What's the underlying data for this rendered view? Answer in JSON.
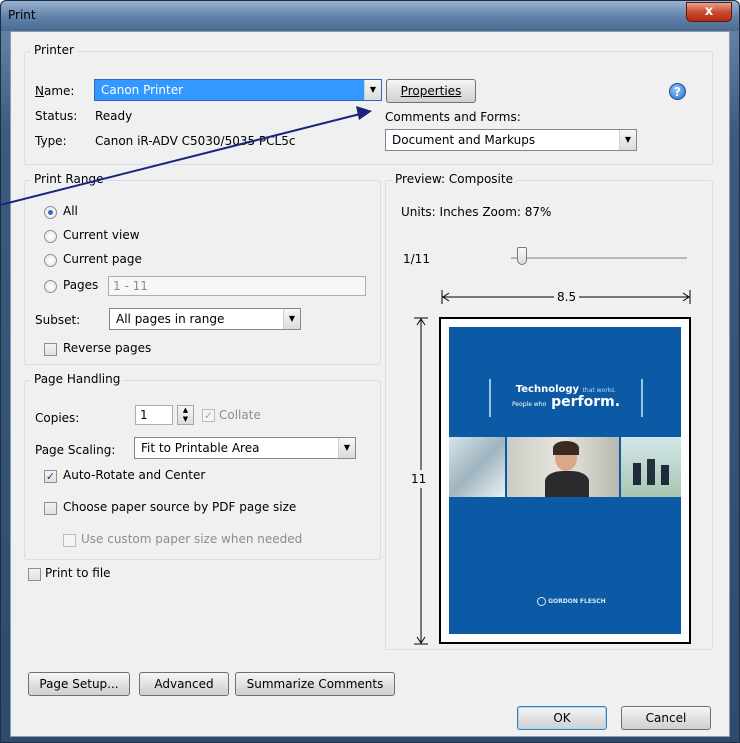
{
  "window": {
    "title": "Print",
    "close_glyph": "x"
  },
  "printer": {
    "legend": "Printer",
    "name_label": "Name:",
    "name_value": "Canon Printer",
    "status_label": "Status:",
    "status_value": "Ready",
    "type_label": "Type:",
    "type_value": "Canon iR-ADV C5030/5035 PCL5c",
    "properties_label": "Properties",
    "comments_label": "Comments and Forms:",
    "comments_value": "Document and Markups"
  },
  "range": {
    "legend": "Print Range",
    "all": "All",
    "current_view": "Current view",
    "current_page": "Current page",
    "pages": "Pages",
    "pages_value": "1 - 11",
    "subset_label": "Subset:",
    "subset_value": "All pages in range",
    "reverse": "Reverse pages"
  },
  "handling": {
    "legend": "Page Handling",
    "copies_label": "Copies:",
    "copies_value": "1",
    "collate": "Collate",
    "scaling_label": "Page Scaling:",
    "scaling_value": "Fit to Printable Area",
    "auto_rotate": "Auto-Rotate and Center",
    "choose_source": "Choose paper source by PDF page size",
    "custom_size": "Use custom paper size when needed"
  },
  "print_to_file": "Print to file",
  "preview": {
    "legend": "Preview: Composite",
    "units": "Units: Inches Zoom:  87%",
    "page_counter": "1/11",
    "width": "8.5",
    "height": "11",
    "headline_1": "Technology",
    "headline_1b": "that works.",
    "headline_2a": "People who",
    "headline_2b": "perform.",
    "footer_logo": "GORDON FLESCH"
  },
  "buttons": {
    "page_setup": "Page Setup...",
    "advanced": "Advanced",
    "summarize": "Summarize Comments",
    "ok": "OK",
    "cancel": "Cancel"
  },
  "colors": {
    "accent_blue": "#0c5aa6",
    "selection": "#3399ff",
    "annotation_arrow": "#1a237e"
  }
}
